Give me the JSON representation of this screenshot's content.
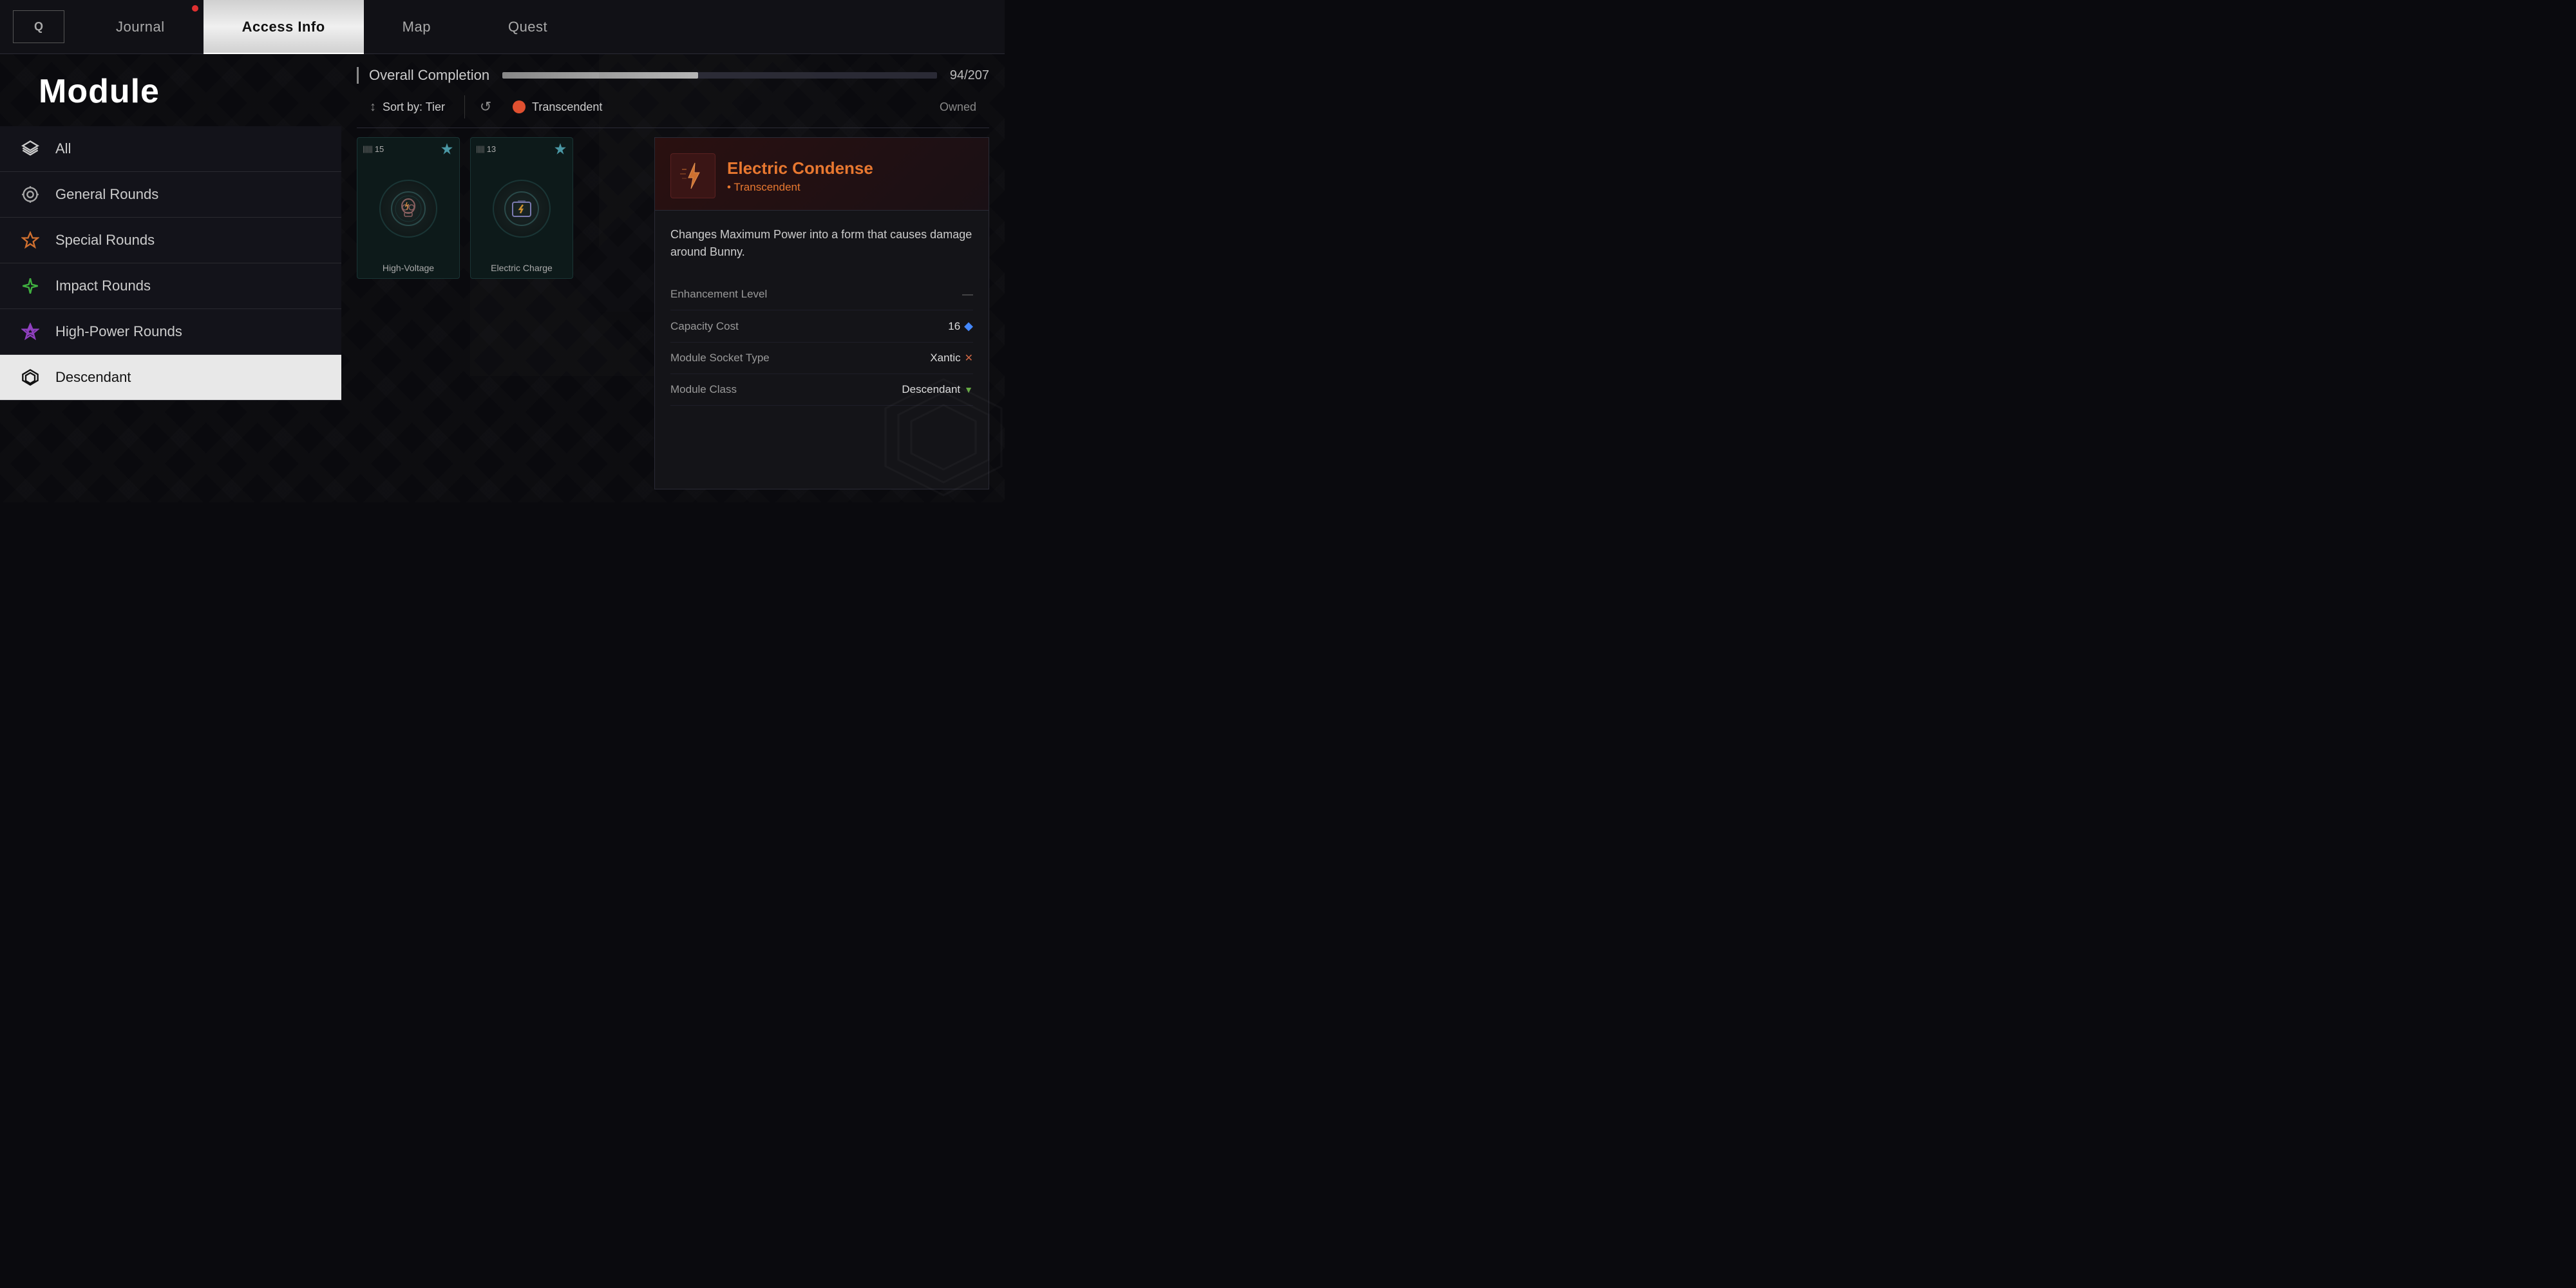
{
  "nav": {
    "q_label": "Q",
    "tabs": [
      {
        "id": "journal",
        "label": "Journal",
        "active": false,
        "has_dot": true
      },
      {
        "id": "access-info",
        "label": "Access Info",
        "active": true,
        "has_dot": false
      },
      {
        "id": "map",
        "label": "Map",
        "active": false,
        "has_dot": false
      },
      {
        "id": "quest",
        "label": "Quest",
        "active": false,
        "has_dot": false
      }
    ]
  },
  "page": {
    "title": "Module"
  },
  "sidebar": {
    "items": [
      {
        "id": "all",
        "label": "All",
        "active": false,
        "icon": "layers-icon"
      },
      {
        "id": "general-rounds",
        "label": "General Rounds",
        "active": false,
        "icon": "general-rounds-icon"
      },
      {
        "id": "special-rounds",
        "label": "Special Rounds",
        "active": false,
        "icon": "special-rounds-icon"
      },
      {
        "id": "impact-rounds",
        "label": "Impact Rounds",
        "active": false,
        "icon": "impact-rounds-icon"
      },
      {
        "id": "high-power-rounds",
        "label": "High-Power Rounds",
        "active": false,
        "icon": "highpower-rounds-icon"
      },
      {
        "id": "descendant",
        "label": "Descendant",
        "active": true,
        "icon": "descendant-icon"
      }
    ]
  },
  "completion": {
    "label": "Overall Completion",
    "current": 94,
    "total": 207,
    "display": "94/207",
    "percent": 45
  },
  "filter": {
    "sort_label": "Sort by: Tier",
    "filter_label": "Transcendent",
    "owned_label": "Owned"
  },
  "cards": [
    {
      "id": "high-voltage",
      "name": "High-Voltage",
      "level": 15,
      "tier": "transcendent"
    },
    {
      "id": "electric-charge",
      "name": "Electric Charge",
      "level": 13,
      "tier": "transcendent"
    }
  ],
  "detail": {
    "title": "Electric Condense",
    "subtitle": "Transcendent",
    "description": "Changes Maximum Power into a form that causes damage around Bunny.",
    "stats": [
      {
        "label": "Enhancement Level",
        "value": "—",
        "type": "text"
      },
      {
        "label": "Capacity Cost",
        "value": "16",
        "type": "capacity"
      },
      {
        "label": "Module Socket Type",
        "value": "Xantic",
        "type": "socket"
      },
      {
        "label": "Module Class",
        "value": "Descendant",
        "type": "class"
      }
    ]
  }
}
